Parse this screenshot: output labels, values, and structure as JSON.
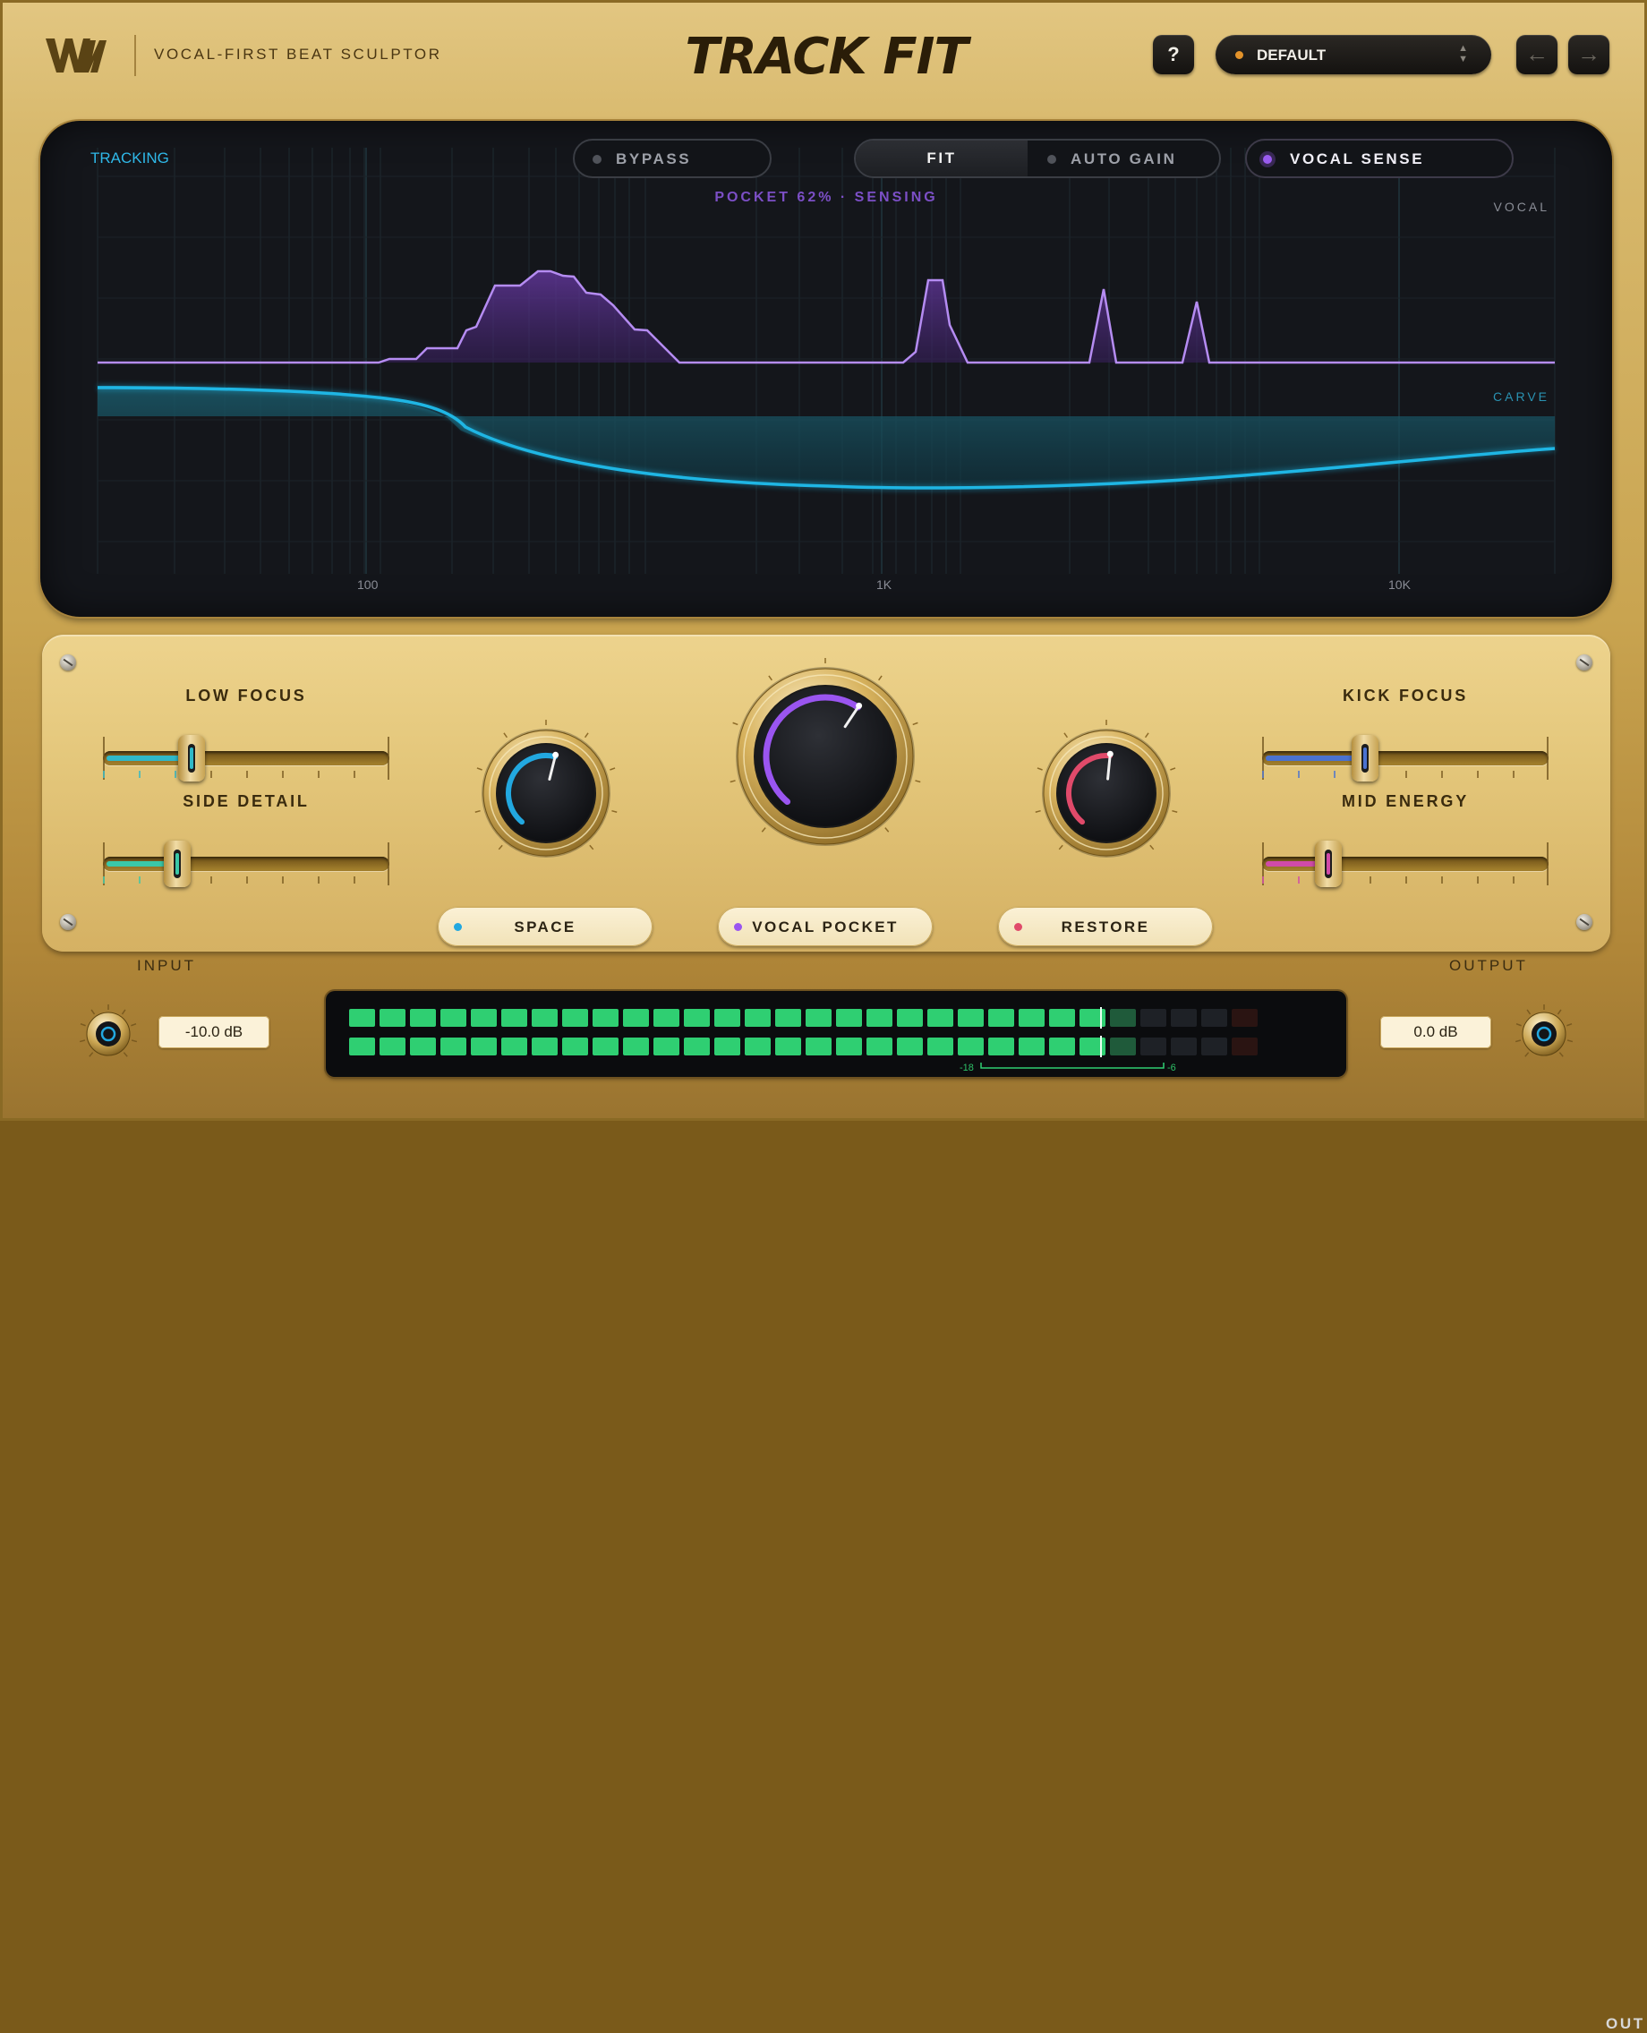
{
  "header": {
    "tagline": "VOCAL-FIRST BEAT SCULPTOR",
    "title": "TRACK FIT",
    "help_label": "?",
    "preset_name": "DEFAULT",
    "preset_dot_color": "#e3922a",
    "prev_arrow": "←",
    "next_arrow": "→"
  },
  "display": {
    "tracking_label": "TRACKING",
    "bypass_label": "BYPASS",
    "fit_label": "FIT",
    "auto_gain_label": "AUTO GAIN",
    "vocal_sense_label": "VOCAL SENSE",
    "status_text": "POCKET 62%  ·  SENSING",
    "vocal_label": "VOCAL",
    "carve_label": "CARVE",
    "freq_labels": [
      "100",
      "1K",
      "10K"
    ],
    "colors": {
      "vocal": "#9a6ae6",
      "carve": "#1fb6e4",
      "tracking": "#2fb8e8"
    }
  },
  "controls": {
    "low_focus": {
      "label": "LOW FOCUS",
      "value": 0.31,
      "color": "#2fb8c8"
    },
    "side_detail": {
      "label": "SIDE DETAIL",
      "value": 0.26,
      "color": "#3ac8a8"
    },
    "kick_focus": {
      "label": "KICK FOCUS",
      "value": 0.36,
      "color": "#4a72d0"
    },
    "mid_energy": {
      "label": "MID ENERGY",
      "value": 0.23,
      "color": "#d04aa8"
    },
    "space": {
      "label": "SPACE",
      "value": 0.55,
      "color": "#22a8e0"
    },
    "vocal_pocket": {
      "label": "VOCAL POCKET",
      "value": 0.62,
      "color": "#9a55f0"
    },
    "restore": {
      "label": "RESTORE",
      "value": 0.52,
      "color": "#e04a6a"
    }
  },
  "io": {
    "input_label": "INPUT",
    "input_value": "-10.0 dB",
    "output_label": "OUTPUT",
    "output_value": "0.0 dB",
    "meter_out_label": "OUT",
    "meter_range_low": "-18",
    "meter_range_high": "-6",
    "meter_level_top": 0.87,
    "meter_level_bottom": 0.86
  }
}
